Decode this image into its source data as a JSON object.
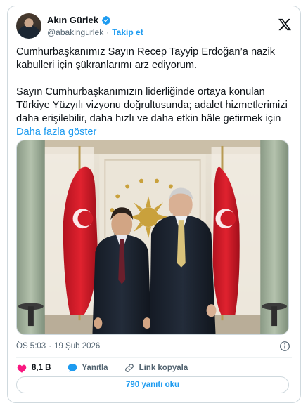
{
  "author": {
    "name": "Akın Gürlek",
    "handle": "@abakingurlek",
    "separator": "·",
    "follow_label": "Takip et"
  },
  "tweet": {
    "paragraph1": "Cumhurbaşkanımız Sayın Recep Tayyip Erdoğan’a nazik kabulleri için şükranlarımı arz ediyorum.",
    "paragraph2": "Sayın Cumhurbaşkanımızın liderliğinde ortaya konulan Türkiye Yüzyılı vizyonu doğrultusunda; adalet hizmetlerimizi daha erişilebilir, daha hızlı ve daha etkin hâle getirmek için",
    "show_more_label": "Daha fazla göster"
  },
  "meta": {
    "time": "ÖS 5:03",
    "separator": "·",
    "date": "19 Şub 2026"
  },
  "actions": {
    "like_count": "8,1 B",
    "reply_label": "Yanıtla",
    "copy_link_label": "Link kopyala",
    "read_replies_label": "790 yanıtı oku"
  },
  "colors": {
    "accent": "#1d9bf0",
    "like": "#f91880",
    "text": "#0f1419",
    "muted": "#536471"
  },
  "icons": [
    "verified-badge-icon",
    "x-logo-icon",
    "info-icon",
    "heart-icon",
    "reply-bubble-icon",
    "link-icon"
  ]
}
